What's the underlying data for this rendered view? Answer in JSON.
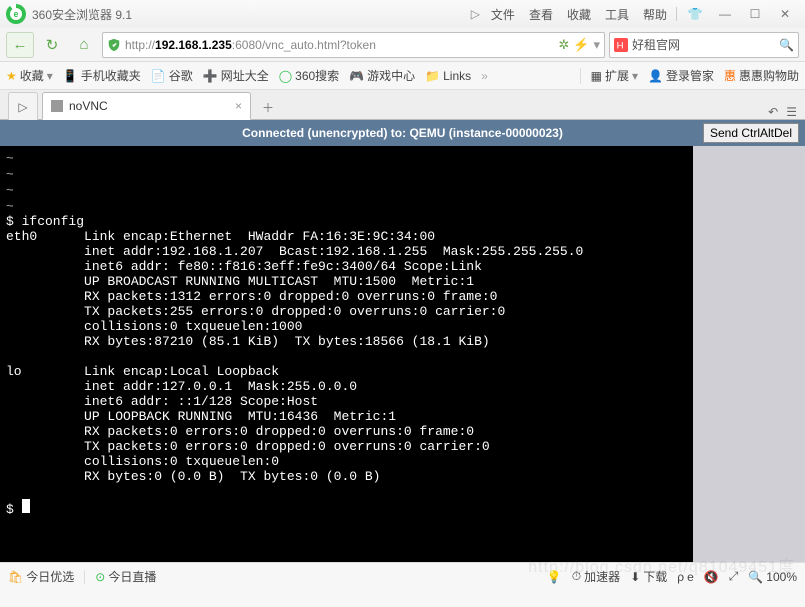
{
  "title": "360安全浏览器 9.1",
  "menu": [
    "文件",
    "查看",
    "收藏",
    "工具",
    "帮助"
  ],
  "nav": {
    "back": "←",
    "forward": "→",
    "reload": "↻",
    "home": "⌂"
  },
  "url": {
    "proto": "http://",
    "host": "192.168.1.235",
    "port": ":6080",
    "path": "/vnc_auto.html?token"
  },
  "search": {
    "default": "好租官网"
  },
  "bookbar": {
    "fav": "收藏",
    "items": [
      "手机收藏夹",
      "谷歌",
      "网址大全",
      "360搜索",
      "游戏中心",
      "Links"
    ],
    "ext": "扩展",
    "login": "登录管家",
    "hui": "惠惠购物助"
  },
  "tab": {
    "label": "noVNC"
  },
  "vnc": {
    "status": "Connected (unencrypted) to: QEMU (instance-00000023)",
    "send": "Send CtrlAltDel"
  },
  "terminal_lines": [
    "~",
    "~",
    "~",
    "~",
    "$ ifconfig",
    "eth0      Link encap:Ethernet  HWaddr FA:16:3E:9C:34:00",
    "          inet addr:192.168.1.207  Bcast:192.168.1.255  Mask:255.255.255.0",
    "          inet6 addr: fe80::f816:3eff:fe9c:3400/64 Scope:Link",
    "          UP BROADCAST RUNNING MULTICAST  MTU:1500  Metric:1",
    "          RX packets:1312 errors:0 dropped:0 overruns:0 frame:0",
    "          TX packets:255 errors:0 dropped:0 overruns:0 carrier:0",
    "          collisions:0 txqueuelen:1000",
    "          RX bytes:87210 (85.1 KiB)  TX bytes:18566 (18.1 KiB)",
    "",
    "lo        Link encap:Local Loopback",
    "          inet addr:127.0.0.1  Mask:255.0.0.0",
    "          inet6 addr: ::1/128 Scope:Host",
    "          UP LOOPBACK RUNNING  MTU:16436  Metric:1",
    "          RX packets:0 errors:0 dropped:0 overruns:0 frame:0",
    "          TX packets:0 errors:0 dropped:0 overruns:0 carrier:0",
    "          collisions:0 txqueuelen:0",
    "          RX bytes:0 (0.0 B)  TX bytes:0 (0.0 B)",
    "",
    "$ "
  ],
  "status": {
    "left": [
      "今日优选",
      "今日直播"
    ],
    "acc": "加速器",
    "down": "下载",
    "e": "e",
    "mute": "🔇",
    "full": "⤢",
    "zoom": "100%"
  },
  "watermark": "http://blog.csdn.net/q81049451度"
}
